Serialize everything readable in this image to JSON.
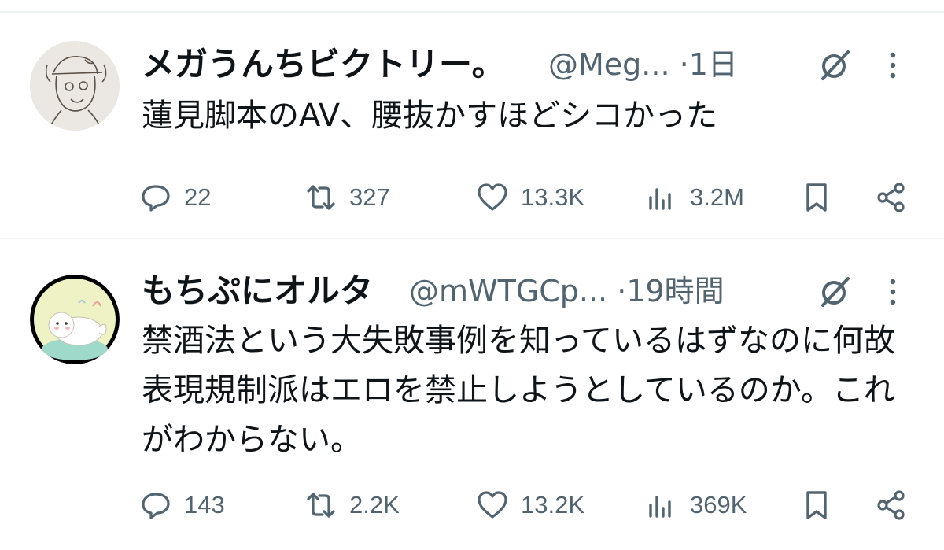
{
  "tweets": [
    {
      "name": "メガうんちビクトリー。",
      "handle": "@Meg...",
      "time": "1日",
      "text": "蓮見脚本のAV、腰抜かすほどシコかった",
      "replies": "22",
      "retweets": "327",
      "likes": "13.3K",
      "views": "3.2M",
      "avatar_icon": "sketch-avatar"
    },
    {
      "name": "もちぷにオルタ",
      "handle": "@mWTGCp...",
      "time": "19時間",
      "text": "禁酒法という大失敗事例を知っているはずなのに何故表現規制派はエロを禁止しようとしているのか。これがわからない。",
      "replies": "143",
      "retweets": "2.2K",
      "likes": "13.2K",
      "views": "369K",
      "avatar_icon": "seal-avatar"
    }
  ],
  "colors": {
    "muted": "#536471",
    "text": "#0f1419",
    "divider": "#eff3f4"
  }
}
